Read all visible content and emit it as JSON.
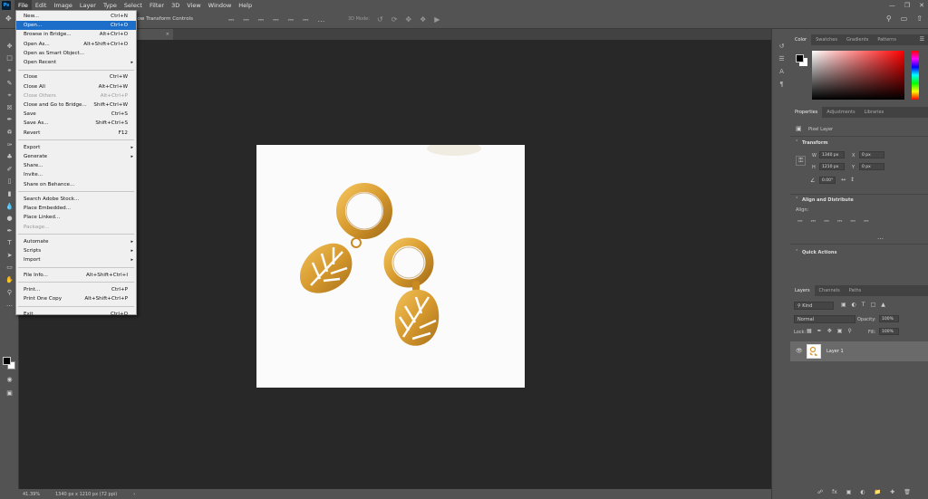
{
  "app": {
    "logo": "Ps",
    "menus": [
      "File",
      "Edit",
      "Image",
      "Layer",
      "Type",
      "Select",
      "Filter",
      "3D",
      "View",
      "Window",
      "Help"
    ],
    "active_menu": "File"
  },
  "options_bar": {
    "transform_label": "how Transform Controls",
    "mode_3d": "3D Mode:"
  },
  "file_menu": {
    "groups": [
      [
        {
          "label": "New...",
          "shortcut": "Ctrl+N"
        },
        {
          "label": "Open...",
          "shortcut": "Ctrl+O",
          "highlight": true
        },
        {
          "label": "Browse in Bridge...",
          "shortcut": "Alt+Ctrl+O"
        },
        {
          "label": "Open As...",
          "shortcut": "Alt+Shift+Ctrl+O"
        },
        {
          "label": "Open as Smart Object...",
          "shortcut": ""
        },
        {
          "label": "Open Recent",
          "shortcut": "",
          "submenu": true
        }
      ],
      [
        {
          "label": "Close",
          "shortcut": "Ctrl+W"
        },
        {
          "label": "Close All",
          "shortcut": "Alt+Ctrl+W"
        },
        {
          "label": "Close Others",
          "shortcut": "Alt+Ctrl+P",
          "disabled": true
        },
        {
          "label": "Close and Go to Bridge...",
          "shortcut": "Shift+Ctrl+W"
        },
        {
          "label": "Save",
          "shortcut": "Ctrl+S"
        },
        {
          "label": "Save As...",
          "shortcut": "Shift+Ctrl+S"
        },
        {
          "label": "Revert",
          "shortcut": "F12"
        }
      ],
      [
        {
          "label": "Export",
          "shortcut": "",
          "submenu": true
        },
        {
          "label": "Generate",
          "shortcut": "",
          "submenu": true
        },
        {
          "label": "Share...",
          "shortcut": ""
        },
        {
          "label": "Invite...",
          "shortcut": ""
        },
        {
          "label": "Share on Behance...",
          "shortcut": ""
        }
      ],
      [
        {
          "label": "Search Adobe Stock...",
          "shortcut": ""
        },
        {
          "label": "Place Embedded...",
          "shortcut": ""
        },
        {
          "label": "Place Linked...",
          "shortcut": ""
        },
        {
          "label": "Package...",
          "shortcut": "",
          "disabled": true
        }
      ],
      [
        {
          "label": "Automate",
          "shortcut": "",
          "submenu": true
        },
        {
          "label": "Scripts",
          "shortcut": "",
          "submenu": true
        },
        {
          "label": "Import",
          "shortcut": "",
          "submenu": true
        }
      ],
      [
        {
          "label": "File Info...",
          "shortcut": "Alt+Shift+Ctrl+I"
        }
      ],
      [
        {
          "label": "Print...",
          "shortcut": "Ctrl+P"
        },
        {
          "label": "Print One Copy",
          "shortcut": "Alt+Shift+Ctrl+P"
        }
      ],
      [
        {
          "label": "Exit",
          "shortcut": "Ctrl+Q"
        }
      ]
    ]
  },
  "color_panel": {
    "tabs": [
      "Color",
      "Swatches",
      "Gradients",
      "Patterns"
    ],
    "active_tab": "Color"
  },
  "properties_panel": {
    "tabs": [
      "Properties",
      "Adjustments",
      "Libraries"
    ],
    "active_tab": "Properties",
    "layer_type": "Pixel Layer",
    "transform_heading": "Transform",
    "w_label": "W",
    "w_value": "1340 px",
    "h_label": "H",
    "h_value": "1210 px",
    "x_label": "X",
    "x_value": "0 px",
    "y_label": "Y",
    "y_value": "0 px",
    "angle_value": "0.00°",
    "align_heading": "Align and Distribute",
    "align_label": "Align:",
    "quick_actions_heading": "Quick Actions"
  },
  "layers_panel": {
    "tabs": [
      "Layers",
      "Channels",
      "Paths"
    ],
    "active_tab": "Layers",
    "kind_filter": "Kind",
    "blend_mode": "Normal",
    "opacity_label": "Opacity:",
    "opacity_value": "100%",
    "lock_label": "Lock:",
    "fill_label": "Fill:",
    "fill_value": "100%",
    "layers": [
      {
        "name": "Layer 1"
      }
    ]
  },
  "status_bar": {
    "zoom": "41.39%",
    "doc_info": "1340 px x 1210 px (72 ppi)"
  },
  "colors": {
    "ui_bg": "#535353",
    "canvas_bg": "#282828",
    "menu_highlight": "#1d6ec9",
    "gold": "#d79a2e"
  }
}
